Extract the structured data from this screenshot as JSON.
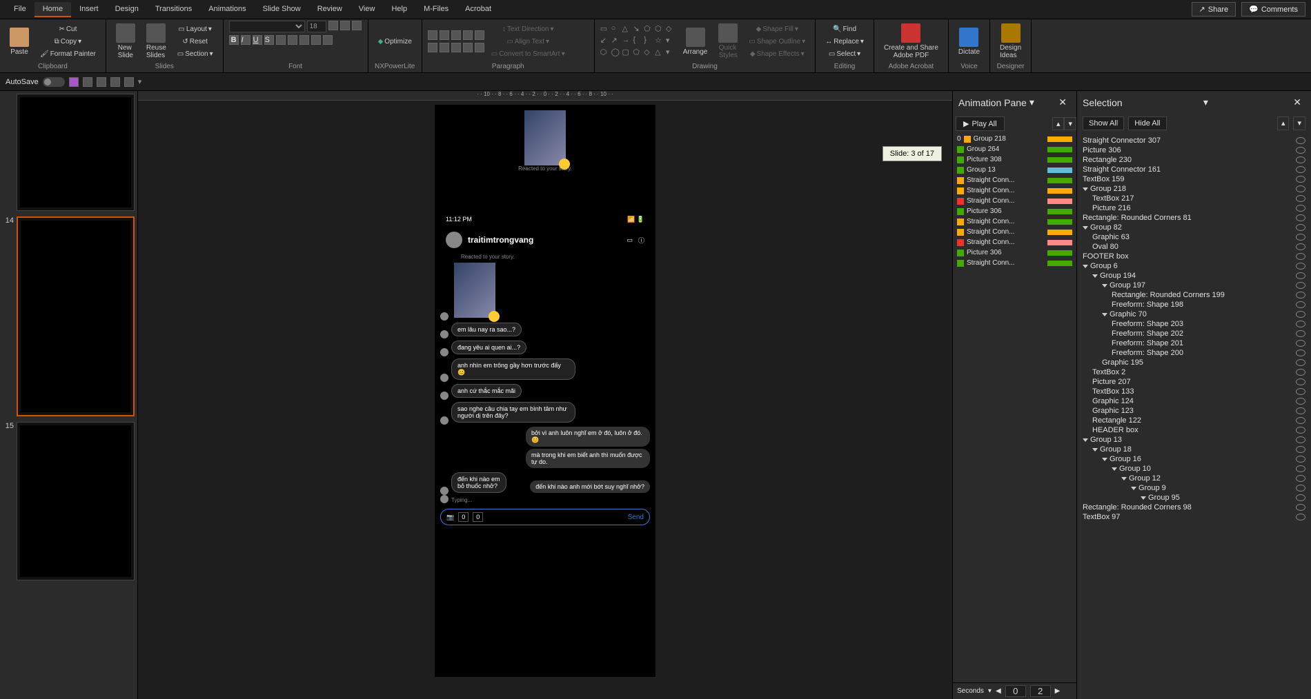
{
  "menu": {
    "items": [
      "File",
      "Home",
      "Insert",
      "Design",
      "Transitions",
      "Animations",
      "Slide Show",
      "Review",
      "View",
      "Help",
      "M-Files",
      "Acrobat"
    ],
    "active": "Home",
    "share": "Share",
    "comments": "Comments"
  },
  "ribbon": {
    "clipboard": {
      "paste": "Paste",
      "cut": "Cut",
      "copy": "Copy",
      "format_painter": "Format Painter",
      "label": "Clipboard"
    },
    "slides": {
      "new_slide": "New\nSlide",
      "reuse": "Reuse\nSlides",
      "layout": "Layout",
      "reset": "Reset",
      "section": "Section",
      "label": "Slides"
    },
    "font": {
      "label": "Font",
      "size": "18"
    },
    "nxp": {
      "optimize": "Optimize",
      "label": "NXPowerLite"
    },
    "paragraph": {
      "label": "Paragraph",
      "text_direction": "Text Direction",
      "align_text": "Align Text",
      "smartart": "Convert to SmartArt"
    },
    "drawing": {
      "arrange": "Arrange",
      "quick": "Quick\nStyles",
      "fill": "Shape Fill",
      "outline": "Shape Outline",
      "effects": "Shape Effects",
      "label": "Drawing"
    },
    "editing": {
      "find": "Find",
      "replace": "Replace",
      "select": "Select",
      "label": "Editing"
    },
    "adobe": {
      "btn": "Create and Share\nAdobe PDF",
      "label": "Adobe Acrobat"
    },
    "voice": {
      "dictate": "Dictate",
      "label": "Voice"
    },
    "designer": {
      "btn": "Design\nIdeas",
      "label": "Designer"
    }
  },
  "qat": {
    "autosave": "AutoSave"
  },
  "thumbs": [
    {
      "num": ""
    },
    {
      "num": "14"
    },
    {
      "num": "15"
    }
  ],
  "tooltip": "Slide: 3 of 17",
  "slide": {
    "time": "11:12 PM",
    "user": "traitimtrongvang",
    "reacted": "Reacted to your story.",
    "msgs_left": [
      "em lâu nay ra sao...?",
      "đang yêu ai quen ai...?",
      "anh nhìn em trông gầy hơn trước đấy 😊",
      "anh cứ thắc mắc mãi",
      "sao nghe câu chia tay em bình tâm như người dị trên đây?"
    ],
    "msgs_right": [
      "bởi vì anh luôn nghĩ em ở đó, luôn ở đó. 😊",
      "mà trong khi em biết anh thì muốn được tự do."
    ],
    "msg_split_l": "đến khi nào em\nbỏ thuốc nhở?",
    "msg_split_r": "đến khi nào anh mới bớt suy nghĩ nhở?",
    "typing": "Typing...",
    "send": "Send",
    "zero": "0"
  },
  "anim_pane": {
    "title": "Animation Pane",
    "play": "Play All",
    "items": [
      {
        "t": "Group 218",
        "s": "orange",
        "c": "#fa0"
      },
      {
        "t": "Group 264",
        "s": "green",
        "c": "#4a0"
      },
      {
        "t": "Picture 308",
        "s": "green",
        "c": "#4a0"
      },
      {
        "t": "Group 13",
        "s": "green",
        "c": "#6bd"
      },
      {
        "t": "Straight Conn...",
        "s": "orange",
        "c": "#4a0"
      },
      {
        "t": "Straight Conn...",
        "s": "orange",
        "c": "#fa0"
      },
      {
        "t": "Straight Conn...",
        "s": "red",
        "c": "#f88"
      },
      {
        "t": "Picture 306",
        "s": "green",
        "c": "#4a0"
      },
      {
        "t": "Straight Conn...",
        "s": "orange",
        "c": "#4a0"
      },
      {
        "t": "Straight Conn...",
        "s": "orange",
        "c": "#fa0"
      },
      {
        "t": "Straight Conn...",
        "s": "red",
        "c": "#f88"
      },
      {
        "t": "Picture 306",
        "s": "green",
        "c": "#4a0"
      },
      {
        "t": "Straight Conn...",
        "s": "green",
        "c": "#4a0"
      }
    ],
    "seconds": "Seconds",
    "s0": "0",
    "s2": "2"
  },
  "sel_pane": {
    "title": "Selection",
    "show_all": "Show All",
    "hide_all": "Hide All",
    "items": [
      {
        "t": "Straight Connector 307",
        "i": 0
      },
      {
        "t": "Picture 306",
        "i": 0
      },
      {
        "t": "Rectangle 230",
        "i": 0
      },
      {
        "t": "Straight Connector 161",
        "i": 0
      },
      {
        "t": "TextBox 159",
        "i": 0
      },
      {
        "t": "Group 218",
        "i": 0,
        "g": 1
      },
      {
        "t": "TextBox 217",
        "i": 1
      },
      {
        "t": "Picture 216",
        "i": 1
      },
      {
        "t": "Rectangle: Rounded Corners 81",
        "i": 0
      },
      {
        "t": "Group 82",
        "i": 0,
        "g": 1
      },
      {
        "t": "Graphic 63",
        "i": 1
      },
      {
        "t": "Oval 80",
        "i": 1
      },
      {
        "t": "FOOTER box",
        "i": 0
      },
      {
        "t": "Group 6",
        "i": 0,
        "g": 1
      },
      {
        "t": "Group 194",
        "i": 1,
        "g": 1
      },
      {
        "t": "Group 197",
        "i": 2,
        "g": 1
      },
      {
        "t": "Rectangle: Rounded Corners 199",
        "i": 3
      },
      {
        "t": "Freeform: Shape 198",
        "i": 3
      },
      {
        "t": "Graphic 70",
        "i": 2,
        "g": 1
      },
      {
        "t": "Freeform: Shape 203",
        "i": 3
      },
      {
        "t": "Freeform: Shape 202",
        "i": 3
      },
      {
        "t": "Freeform: Shape 201",
        "i": 3
      },
      {
        "t": "Freeform: Shape 200",
        "i": 3
      },
      {
        "t": "Graphic 195",
        "i": 2
      },
      {
        "t": "TextBox 2",
        "i": 1
      },
      {
        "t": "Picture 207",
        "i": 1
      },
      {
        "t": "TextBox 133",
        "i": 1
      },
      {
        "t": "Graphic 124",
        "i": 1
      },
      {
        "t": "Graphic 123",
        "i": 1
      },
      {
        "t": "Rectangle 122",
        "i": 1
      },
      {
        "t": "HEADER box",
        "i": 1
      },
      {
        "t": "Group 13",
        "i": 0,
        "g": 1
      },
      {
        "t": "Group 18",
        "i": 1,
        "g": 1
      },
      {
        "t": "Group 16",
        "i": 2,
        "g": 1
      },
      {
        "t": "Group 10",
        "i": 3,
        "g": 1
      },
      {
        "t": "Group 12",
        "i": 4,
        "g": 1
      },
      {
        "t": "Group 9",
        "i": 5,
        "g": 1
      },
      {
        "t": "Group 95",
        "i": 6,
        "g": 1
      },
      {
        "t": "Rectangle: Rounded Corners 98",
        "i": 7
      },
      {
        "t": "TextBox 97",
        "i": 7
      }
    ]
  }
}
